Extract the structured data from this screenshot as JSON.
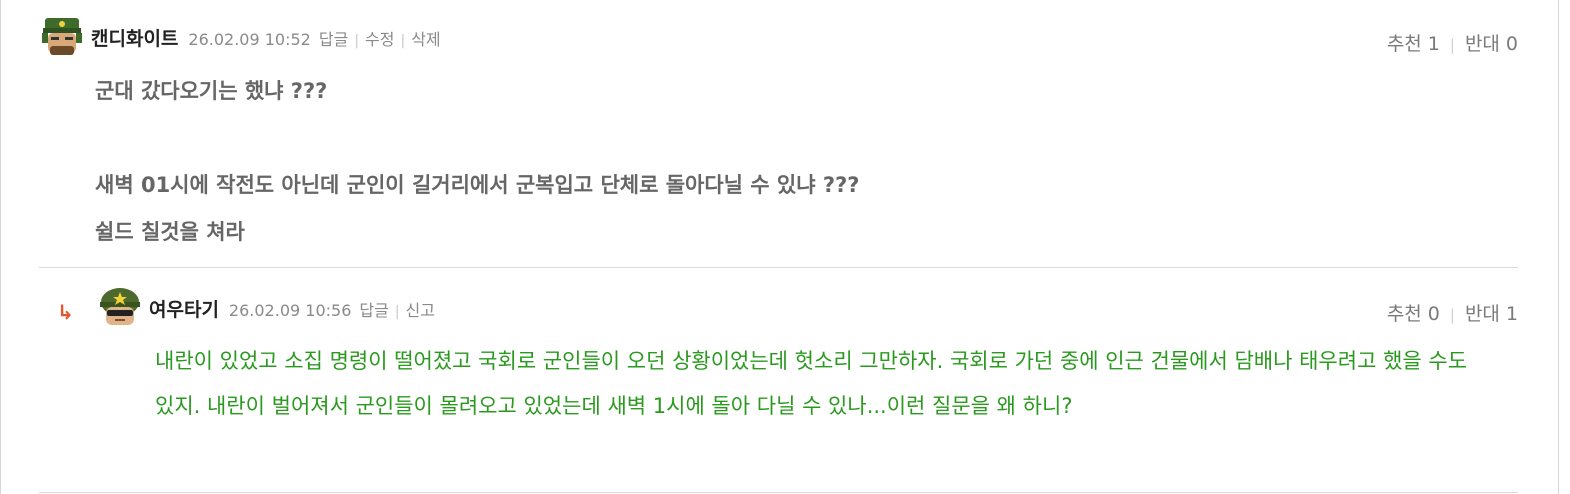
{
  "comments": [
    {
      "nickname": "캔디화이트",
      "date": "26.02.09 10:52",
      "actions": [
        "답글",
        "수정",
        "삭제"
      ],
      "votes": {
        "up_label": "추천",
        "up": "1",
        "down_label": "반대",
        "down": "0"
      },
      "body_lines": [
        "군대 갔다오기는 했냐 ???",
        "",
        "새벽 01시에 작전도 아닌데 군인이 길거리에서 군복입고 단체로 돌아다닐 수 있냐 ???",
        "쉴드 칠것을 쳐라"
      ]
    },
    {
      "reply_icon": "reply-arrow-icon",
      "nickname": "여우타기",
      "date": "26.02.09 10:56",
      "actions": [
        "답글",
        "신고"
      ],
      "votes": {
        "up_label": "추천",
        "up": "0",
        "down_label": "반대",
        "down": "1"
      },
      "body": "내란이 있었고 소집 명령이 떨어졌고 국회로 군인들이 오던 상황이었는데 헛소리 그만하자. 국회로 가던 중에 인근 건물에서 담배나 태우려고 했을 수도 있지. 내란이 벌어져서 군인들이 몰려오고 있었는데 새벽 1시에 돌아 다닐 수 있나...이런 질문을 왜 하니?",
      "body_color": "#2a9a1f"
    }
  ]
}
